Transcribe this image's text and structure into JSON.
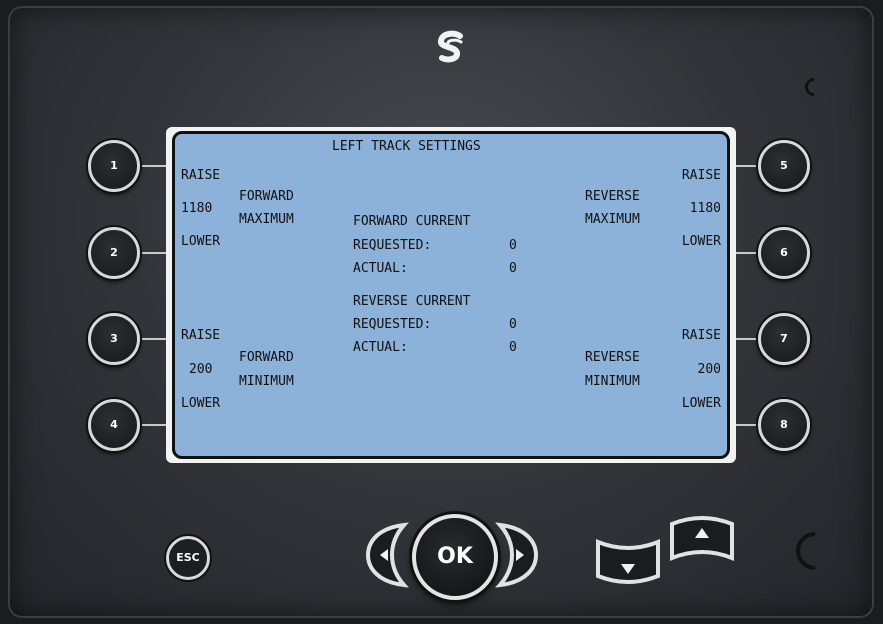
{
  "screen": {
    "title": "LEFT TRACK SETTINGS",
    "forward_max": {
      "raise": "RAISE",
      "value": "1180",
      "label1": "FORWARD",
      "label2": "MAXIMUM",
      "lower": "LOWER"
    },
    "reverse_max": {
      "raise": "RAISE",
      "value": "1180",
      "label1": "REVERSE",
      "label2": "MAXIMUM",
      "lower": "LOWER"
    },
    "forward_min": {
      "raise": "RAISE",
      "value": "200",
      "label1": "FORWARD",
      "label2": "MINIMUM",
      "lower": "LOWER"
    },
    "reverse_min": {
      "raise": "RAISE",
      "value": "200",
      "label1": "REVERSE",
      "label2": "MINIMUM",
      "lower": "LOWER"
    },
    "forward_current": {
      "heading": "FORWARD CURRENT",
      "requested_label": "REQUESTED:",
      "requested_value": "0",
      "actual_label": "ACTUAL:",
      "actual_value": "0"
    },
    "reverse_current": {
      "heading": "REVERSE CURRENT",
      "requested_label": "REQUESTED:",
      "requested_value": "0",
      "actual_label": "ACTUAL:",
      "actual_value": "0"
    }
  },
  "softkeys": [
    "1",
    "2",
    "3",
    "4",
    "5",
    "6",
    "7",
    "8"
  ],
  "nav": {
    "esc": "ESC",
    "ok": "OK"
  },
  "colors": {
    "screen_bg": "#8db2da",
    "bezel": "#34363b",
    "button_ring": "#d8d8d8"
  },
  "icons": {
    "logo": "s-logo-icon",
    "left": "left-arrow-icon",
    "right": "right-arrow-icon",
    "up": "up-arrow-icon",
    "down": "down-arrow-icon"
  }
}
